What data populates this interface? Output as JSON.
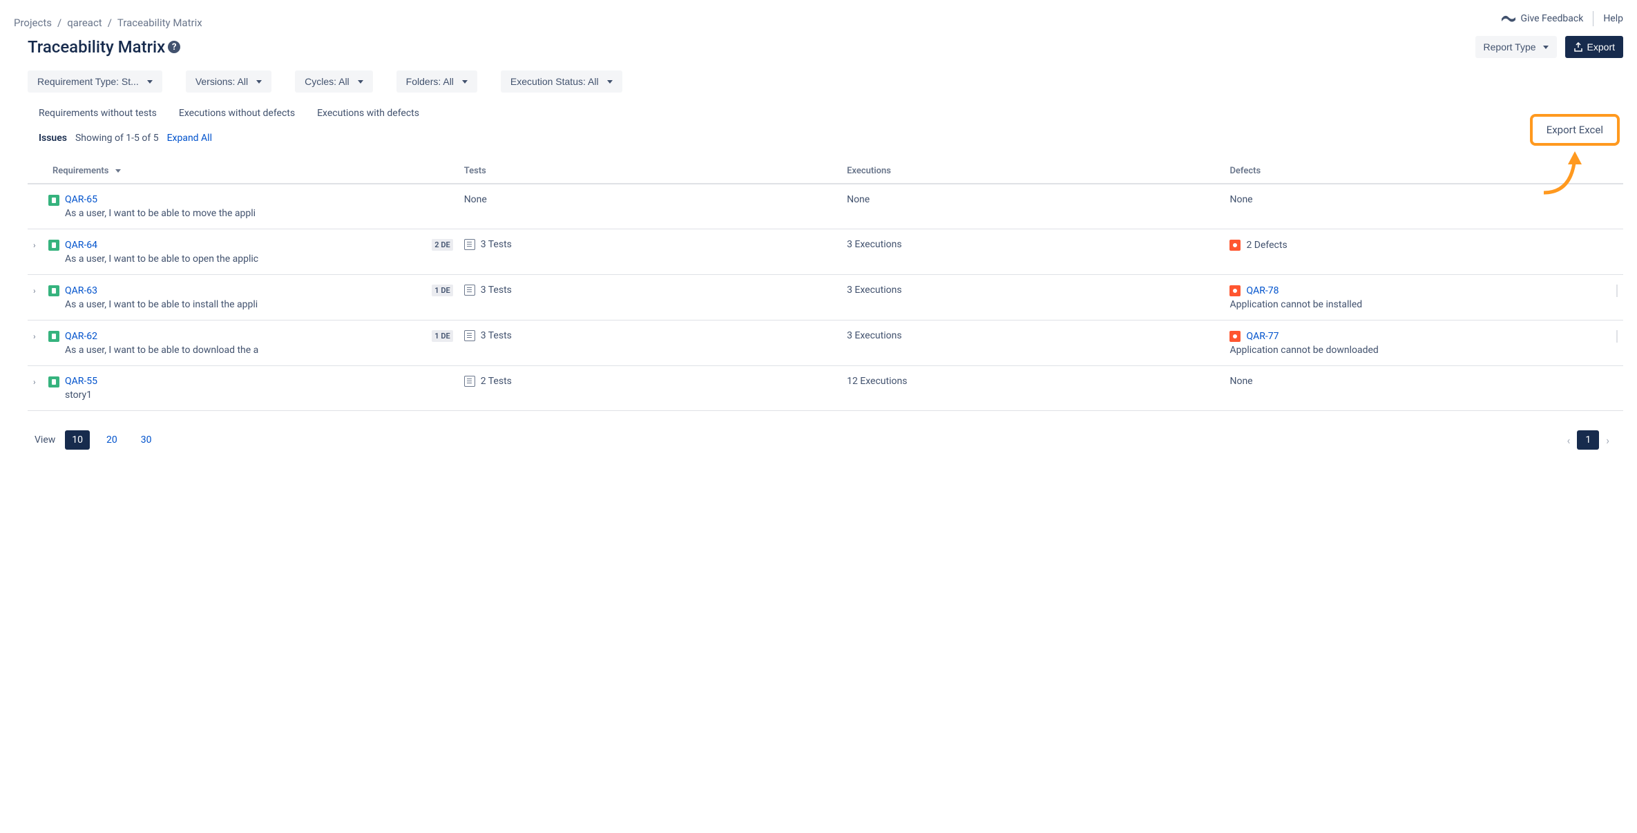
{
  "breadcrumbs": {
    "projects": "Projects",
    "project": "qareact",
    "page": "Traceability Matrix"
  },
  "header": {
    "feedback": "Give Feedback",
    "help": "Help"
  },
  "title": "Traceability Matrix",
  "actions": {
    "report_type": "Report Type",
    "export": "Export",
    "export_excel": "Export Excel"
  },
  "filters": {
    "requirement_type": "Requirement Type: St...",
    "versions": "Versions: All",
    "cycles": "Cycles: All",
    "folders": "Folders: All",
    "execution_status": "Execution Status: All"
  },
  "quick_links": {
    "req_without_tests": "Requirements without tests",
    "exec_without_defects": "Executions without defects",
    "exec_with_defects": "Executions with defects"
  },
  "issues": {
    "label": "Issues",
    "showing": "Showing of 1-5 of 5",
    "expand": "Expand All"
  },
  "columns": {
    "requirements": "Requirements",
    "tests": "Tests",
    "executions": "Executions",
    "defects": "Defects"
  },
  "rows": [
    {
      "expandable": false,
      "id": "QAR-65",
      "desc": "As a user, I want to be able to move the appli",
      "de_badge": "",
      "tests": "None",
      "executions": "None",
      "defects_text": "None",
      "defect_id": "",
      "defect_desc": ""
    },
    {
      "expandable": true,
      "id": "QAR-64",
      "desc": "As a user, I want to be able to open the applic",
      "de_badge": "2 DE",
      "tests": "3 Tests",
      "executions": "3 Executions",
      "defects_text": "2 Defects",
      "defect_id": "",
      "defect_desc": ""
    },
    {
      "expandable": true,
      "id": "QAR-63",
      "desc": "As a user, I want to be able to install the appli",
      "de_badge": "1 DE",
      "tests": "3 Tests",
      "executions": "3 Executions",
      "defects_text": "",
      "defect_id": "QAR-78",
      "defect_desc": "Application cannot be installed"
    },
    {
      "expandable": true,
      "id": "QAR-62",
      "desc": "As a user, I want to be able to download the a",
      "de_badge": "1 DE",
      "tests": "3 Tests",
      "executions": "3 Executions",
      "defects_text": "",
      "defect_id": "QAR-77",
      "defect_desc": "Application cannot be downloaded"
    },
    {
      "expandable": true,
      "id": "QAR-55",
      "desc": "story1",
      "de_badge": "",
      "tests": "2 Tests",
      "executions": "12 Executions",
      "defects_text": "None",
      "defect_id": "",
      "defect_desc": ""
    }
  ],
  "pagination": {
    "view_label": "View",
    "sizes": [
      "10",
      "20",
      "30"
    ],
    "active_size": "10",
    "current_page": "1"
  }
}
